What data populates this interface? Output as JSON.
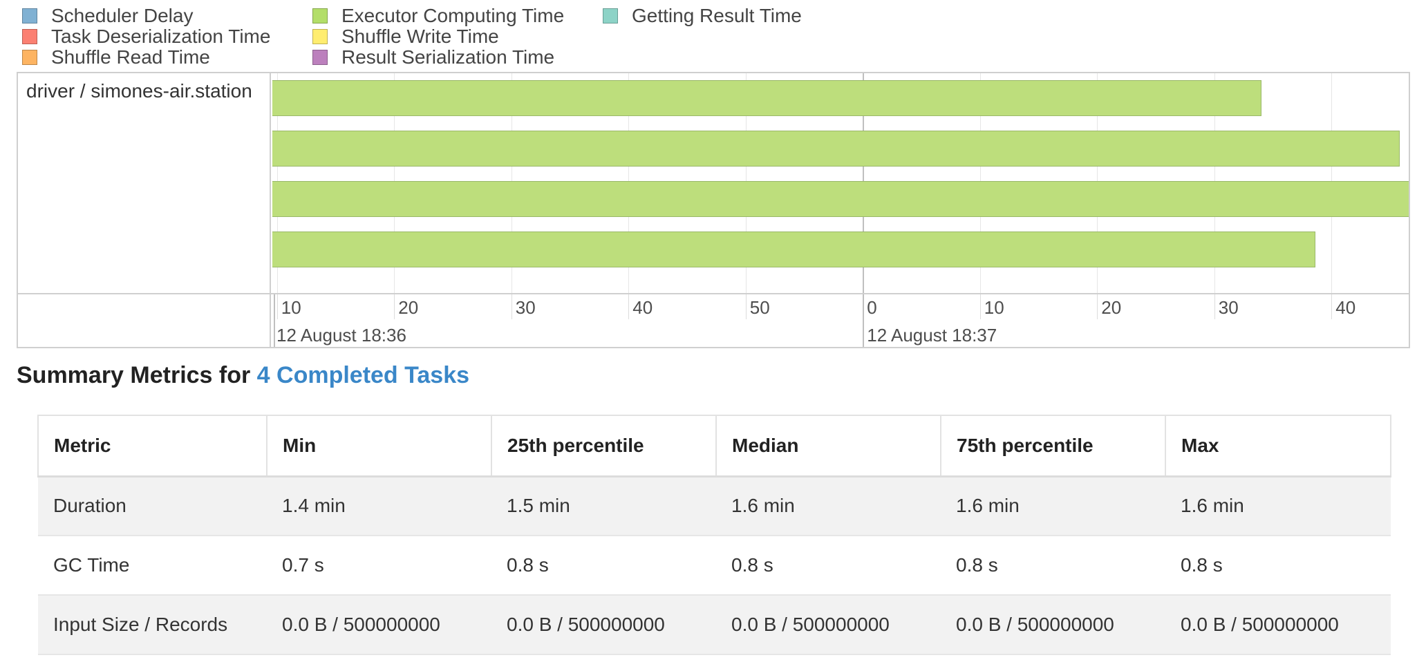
{
  "legend": [
    {
      "label": "Scheduler Delay",
      "color": "#80b1d3"
    },
    {
      "label": "Task Deserialization Time",
      "color": "#fb8072"
    },
    {
      "label": "Shuffle Read Time",
      "color": "#fdb462"
    },
    {
      "label": "Executor Computing Time",
      "color": "#b3de69"
    },
    {
      "label": "Shuffle Write Time",
      "color": "#ffed6f"
    },
    {
      "label": "Result Serialization Time",
      "color": "#bc80bd"
    },
    {
      "label": "Getting Result Time",
      "color": "#8dd3c7"
    }
  ],
  "timeline": {
    "group_label": "driver / simones-air.station",
    "minor_ticks": [
      "10",
      "20",
      "30",
      "40",
      "50",
      "0",
      "10",
      "20",
      "30",
      "40"
    ],
    "major_ticks": [
      "12 August 18:36",
      "12 August 18:37"
    ],
    "bar_color": "#bdde7c",
    "tasks": [
      {
        "start_s": 9.4,
        "end_s": 94.0
      },
      {
        "start_s": 9.4,
        "end_s": 105.8
      },
      {
        "start_s": 9.4,
        "end_s": 107.5
      },
      {
        "start_s": 9.4,
        "end_s": 98.6
      }
    ]
  },
  "summary": {
    "title_prefix": "Summary Metrics for ",
    "title_link": "4 Completed Tasks",
    "link_color": "#3a87c8"
  },
  "metrics_table": {
    "headers": [
      "Metric",
      "Min",
      "25th percentile",
      "Median",
      "75th percentile",
      "Max"
    ],
    "rows": [
      [
        "Duration",
        "1.4 min",
        "1.5 min",
        "1.6 min",
        "1.6 min",
        "1.6 min"
      ],
      [
        "GC Time",
        "0.7 s",
        "0.8 s",
        "0.8 s",
        "0.8 s",
        "0.8 s"
      ],
      [
        "Input Size / Records",
        "0.0 B / 500000000",
        "0.0 B / 500000000",
        "0.0 B / 500000000",
        "0.0 B / 500000000",
        "0.0 B / 500000000"
      ]
    ]
  }
}
